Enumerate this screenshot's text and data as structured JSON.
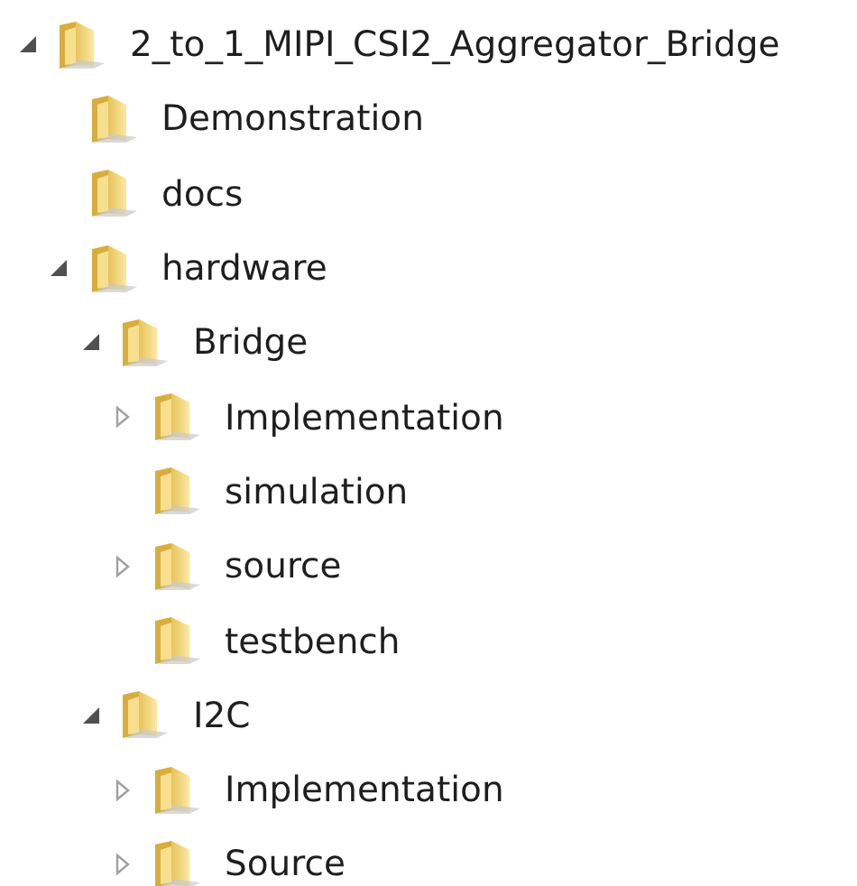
{
  "tree": [
    {
      "label": "2_to_1_MIPI_CSI2_Aggregator_Bridge",
      "kind": "branch",
      "expanded": true,
      "children": [
        {
          "label": "Demonstration",
          "kind": "leaf"
        },
        {
          "label": "docs",
          "kind": "leaf"
        },
        {
          "label": "hardware",
          "kind": "branch",
          "expanded": true,
          "children": [
            {
              "label": "Bridge",
              "kind": "branch",
              "expanded": true,
              "children": [
                {
                  "label": "Implementation",
                  "kind": "branch",
                  "expanded": false
                },
                {
                  "label": "simulation",
                  "kind": "leaf"
                },
                {
                  "label": "source",
                  "kind": "branch",
                  "expanded": false
                },
                {
                  "label": "testbench",
                  "kind": "leaf"
                }
              ]
            },
            {
              "label": "I2C",
              "kind": "branch",
              "expanded": true,
              "children": [
                {
                  "label": "Implementation",
                  "kind": "branch",
                  "expanded": false
                },
                {
                  "label": "Source",
                  "kind": "branch",
                  "expanded": false
                }
              ]
            }
          ]
        }
      ]
    }
  ]
}
